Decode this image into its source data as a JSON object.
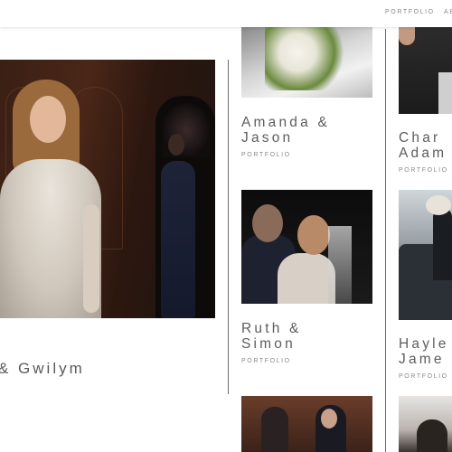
{
  "nav": {
    "items": [
      {
        "label": "PORTFOLIO"
      },
      {
        "label": "AB"
      }
    ]
  },
  "featured": {
    "title": "& Gwilym"
  },
  "portfolio": {
    "entries": [
      {
        "title_line1": "Amanda &",
        "title_line2": "Jason",
        "link_label": "PORTFOLIO"
      },
      {
        "title_line1": "Char",
        "title_line2": "Adam",
        "link_label": "PORTFOLIO"
      },
      {
        "title_line1": "Ruth &",
        "title_line2": "Simon",
        "link_label": "PORTFOLIO"
      },
      {
        "title_line1": "Hayle",
        "title_line2": "Jame",
        "link_label": "PORTFOLIO"
      }
    ]
  },
  "colors": {
    "text": "#5d5d5d",
    "muted": "#8a8a8a",
    "divider": "#6a6a6a",
    "background": "#ffffff"
  }
}
